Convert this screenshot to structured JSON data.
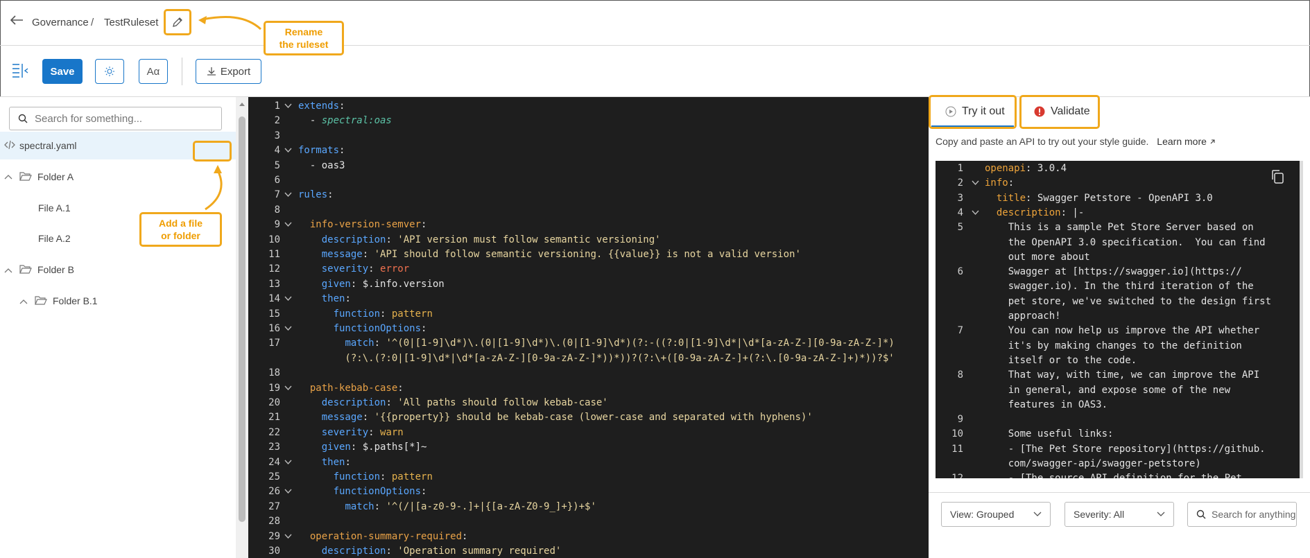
{
  "header": {
    "breadcrumb": [
      "Governance",
      "TestRuleset"
    ],
    "separator": "/"
  },
  "callouts": {
    "rename": "Rename\nthe ruleset",
    "add": "Add a file\nor folder"
  },
  "toolbar": {
    "save_label": "Save",
    "theme_icon": "sun-icon",
    "font_icon": "Aα",
    "export_label": "Export"
  },
  "sidebar": {
    "search_placeholder": "Search for something...",
    "items": [
      {
        "label": "spectral.yaml",
        "type": "file",
        "icon": "code-icon",
        "active": true
      },
      {
        "label": "Folder A",
        "type": "folder"
      },
      {
        "label": "File A.1",
        "type": "file"
      },
      {
        "label": "File A.2",
        "type": "file"
      },
      {
        "label": "Folder B",
        "type": "folder"
      },
      {
        "label": "Folder B.1",
        "type": "folder"
      }
    ]
  },
  "editor": {
    "lines": [
      {
        "n": "1",
        "fold": true,
        "tokens": [
          [
            "k-blue",
            "extends"
          ],
          [
            "k-white",
            ":"
          ]
        ]
      },
      {
        "n": "2",
        "tokens": [
          [
            "k-white",
            "  - "
          ],
          [
            "k-green",
            "spectral:oas"
          ]
        ]
      },
      {
        "n": "3",
        "tokens": []
      },
      {
        "n": "4",
        "fold": true,
        "tokens": [
          [
            "k-blue",
            "formats"
          ],
          [
            "k-white",
            ":"
          ]
        ]
      },
      {
        "n": "5",
        "tokens": [
          [
            "k-white",
            "  - oas3"
          ]
        ]
      },
      {
        "n": "6",
        "tokens": []
      },
      {
        "n": "7",
        "fold": true,
        "tokens": [
          [
            "k-blue",
            "rules"
          ],
          [
            "k-white",
            ":"
          ]
        ]
      },
      {
        "n": "8",
        "tokens": []
      },
      {
        "n": "9",
        "fold": true,
        "tokens": [
          [
            "k-white",
            "  "
          ],
          [
            "k-orange",
            "info-version-semver"
          ],
          [
            "k-white",
            ":"
          ]
        ]
      },
      {
        "n": "10",
        "tokens": [
          [
            "k-white",
            "    "
          ],
          [
            "k-blue",
            "description"
          ],
          [
            "k-white",
            ": "
          ],
          [
            "k-str",
            "'API version must follow semantic versioning'"
          ]
        ]
      },
      {
        "n": "11",
        "tokens": [
          [
            "k-white",
            "    "
          ],
          [
            "k-blue",
            "message"
          ],
          [
            "k-white",
            ": "
          ],
          [
            "k-str",
            "'API should follow semantic versioning. {{value}} is not a valid version'"
          ]
        ]
      },
      {
        "n": "12",
        "tokens": [
          [
            "k-white",
            "    "
          ],
          [
            "k-blue",
            "severity"
          ],
          [
            "k-white",
            ": "
          ],
          [
            "k-red",
            "error"
          ]
        ]
      },
      {
        "n": "13",
        "tokens": [
          [
            "k-white",
            "    "
          ],
          [
            "k-blue",
            "given"
          ],
          [
            "k-white",
            ": $.info.version"
          ]
        ]
      },
      {
        "n": "14",
        "fold": true,
        "tokens": [
          [
            "k-white",
            "    "
          ],
          [
            "k-blue",
            "then"
          ],
          [
            "k-white",
            ":"
          ]
        ]
      },
      {
        "n": "15",
        "tokens": [
          [
            "k-white",
            "      "
          ],
          [
            "k-blue",
            "function"
          ],
          [
            "k-white",
            ": "
          ],
          [
            "k-yellow",
            "pattern"
          ]
        ]
      },
      {
        "n": "16",
        "fold": true,
        "tokens": [
          [
            "k-white",
            "      "
          ],
          [
            "k-blue",
            "functionOptions"
          ],
          [
            "k-white",
            ":"
          ]
        ]
      },
      {
        "n": "17",
        "tokens": [
          [
            "k-white",
            "        "
          ],
          [
            "k-blue",
            "match"
          ],
          [
            "k-white",
            ": "
          ],
          [
            "k-str",
            "'^(0|[1-9]\\d*)\\.(0|[1-9]\\d*)\\.(0|[1-9]\\d*)(?:-((?:0|[1-9]\\d*|\\d*[a-zA-Z-][0-9a-zA-Z-]*)"
          ]
        ]
      },
      {
        "n": "",
        "tokens": [
          [
            "k-str",
            "        (?:\\.(?:0|[1-9]\\d*|\\d*[a-zA-Z-][0-9a-zA-Z-]*))*))?(?:\\+([0-9a-zA-Z-]+(?:\\.[0-9a-zA-Z-]+)*))?$'"
          ]
        ]
      },
      {
        "n": "18",
        "tokens": []
      },
      {
        "n": "19",
        "fold": true,
        "tokens": [
          [
            "k-white",
            "  "
          ],
          [
            "k-orange",
            "path-kebab-case"
          ],
          [
            "k-white",
            ":"
          ]
        ]
      },
      {
        "n": "20",
        "tokens": [
          [
            "k-white",
            "    "
          ],
          [
            "k-blue",
            "description"
          ],
          [
            "k-white",
            ": "
          ],
          [
            "k-str",
            "'All paths should follow kebab-case'"
          ]
        ]
      },
      {
        "n": "21",
        "tokens": [
          [
            "k-white",
            "    "
          ],
          [
            "k-blue",
            "message"
          ],
          [
            "k-white",
            ": "
          ],
          [
            "k-str",
            "'{{property}} should be kebab-case (lower-case and separated with hyphens)'"
          ]
        ]
      },
      {
        "n": "22",
        "tokens": [
          [
            "k-white",
            "    "
          ],
          [
            "k-blue",
            "severity"
          ],
          [
            "k-white",
            ": "
          ],
          [
            "k-yellow",
            "warn"
          ]
        ]
      },
      {
        "n": "23",
        "tokens": [
          [
            "k-white",
            "    "
          ],
          [
            "k-blue",
            "given"
          ],
          [
            "k-white",
            ": $.paths[*]~"
          ]
        ]
      },
      {
        "n": "24",
        "fold": true,
        "tokens": [
          [
            "k-white",
            "    "
          ],
          [
            "k-blue",
            "then"
          ],
          [
            "k-white",
            ":"
          ]
        ]
      },
      {
        "n": "25",
        "tokens": [
          [
            "k-white",
            "      "
          ],
          [
            "k-blue",
            "function"
          ],
          [
            "k-white",
            ": "
          ],
          [
            "k-yellow",
            "pattern"
          ]
        ]
      },
      {
        "n": "26",
        "fold": true,
        "tokens": [
          [
            "k-white",
            "      "
          ],
          [
            "k-blue",
            "functionOptions"
          ],
          [
            "k-white",
            ":"
          ]
        ]
      },
      {
        "n": "27",
        "tokens": [
          [
            "k-white",
            "        "
          ],
          [
            "k-blue",
            "match"
          ],
          [
            "k-white",
            ": "
          ],
          [
            "k-str",
            "'^(/|[a-z0-9-.]+|{[a-zA-Z0-9_]+})+$'"
          ]
        ]
      },
      {
        "n": "28",
        "tokens": []
      },
      {
        "n": "29",
        "fold": true,
        "tokens": [
          [
            "k-white",
            "  "
          ],
          [
            "k-orange",
            "operation-summary-required"
          ],
          [
            "k-white",
            ":"
          ]
        ]
      },
      {
        "n": "30",
        "tokens": [
          [
            "k-white",
            "    "
          ],
          [
            "k-blue",
            "description"
          ],
          [
            "k-white",
            ": "
          ],
          [
            "k-str",
            "'Operation summary required'"
          ]
        ]
      }
    ]
  },
  "right_panel": {
    "tabs": [
      {
        "label": "Try it out",
        "icon": "play-icon",
        "active": true
      },
      {
        "label": "Validate",
        "icon": "error-icon"
      }
    ],
    "description": "Copy and paste an API to try out your style guide.",
    "learn_more": "Learn more",
    "viewer_lines": [
      {
        "n": "1",
        "tokens": [
          [
            "k-gold",
            "openapi"
          ],
          [
            "k-white",
            ": 3.0.4"
          ]
        ]
      },
      {
        "n": "2",
        "fold": true,
        "tokens": [
          [
            "k-gold",
            "info"
          ],
          [
            "k-white",
            ":"
          ]
        ]
      },
      {
        "n": "3",
        "tokens": [
          [
            "k-white",
            "  "
          ],
          [
            "k-gold",
            "title"
          ],
          [
            "k-white",
            ": Swagger Petstore - OpenAPI 3.0"
          ]
        ]
      },
      {
        "n": "4",
        "fold": true,
        "tokens": [
          [
            "k-white",
            "  "
          ],
          [
            "k-gold",
            "description"
          ],
          [
            "k-white",
            ": |-"
          ]
        ]
      },
      {
        "n": "5",
        "tokens": [
          [
            "k-white",
            "    This is a sample Pet Store Server based on"
          ]
        ]
      },
      {
        "n": "",
        "tokens": [
          [
            "k-white",
            "    the OpenAPI 3.0 specification.  You can find"
          ]
        ]
      },
      {
        "n": "",
        "tokens": [
          [
            "k-white",
            "    out more about"
          ]
        ]
      },
      {
        "n": "6",
        "tokens": [
          [
            "k-white",
            "    Swagger at [https://swagger.io](https://"
          ]
        ]
      },
      {
        "n": "",
        "tokens": [
          [
            "k-white",
            "    swagger.io). In the third iteration of the"
          ]
        ]
      },
      {
        "n": "",
        "tokens": [
          [
            "k-white",
            "    pet store, we've switched to the design first"
          ]
        ]
      },
      {
        "n": "",
        "tokens": [
          [
            "k-white",
            "    approach!"
          ]
        ]
      },
      {
        "n": "7",
        "tokens": [
          [
            "k-white",
            "    You can now help us improve the API whether"
          ]
        ]
      },
      {
        "n": "",
        "tokens": [
          [
            "k-white",
            "    it's by making changes to the definition"
          ]
        ]
      },
      {
        "n": "",
        "tokens": [
          [
            "k-white",
            "    itself or to the code."
          ]
        ]
      },
      {
        "n": "8",
        "tokens": [
          [
            "k-white",
            "    That way, with time, we can improve the API"
          ]
        ]
      },
      {
        "n": "",
        "tokens": [
          [
            "k-white",
            "    in general, and expose some of the new"
          ]
        ]
      },
      {
        "n": "",
        "tokens": [
          [
            "k-white",
            "    features in OAS3."
          ]
        ]
      },
      {
        "n": "9",
        "tokens": []
      },
      {
        "n": "10",
        "tokens": [
          [
            "k-white",
            "    Some useful links:"
          ]
        ]
      },
      {
        "n": "11",
        "tokens": [
          [
            "k-white",
            "    - [The Pet Store repository](https://github."
          ]
        ]
      },
      {
        "n": "",
        "tokens": [
          [
            "k-white",
            "    com/swagger-api/swagger-petstore)"
          ]
        ]
      },
      {
        "n": "12",
        "tokens": [
          [
            "k-white",
            "    - [The source API definition for the Pet"
          ]
        ]
      }
    ],
    "view_dropdown": "View: Grouped",
    "severity_dropdown": "Severity: All",
    "search_placeholder": "Search for anything"
  },
  "colors": {
    "accent": "#1876c9",
    "callout": "#f0a81c",
    "editor_bg": "#1e1e1e"
  }
}
